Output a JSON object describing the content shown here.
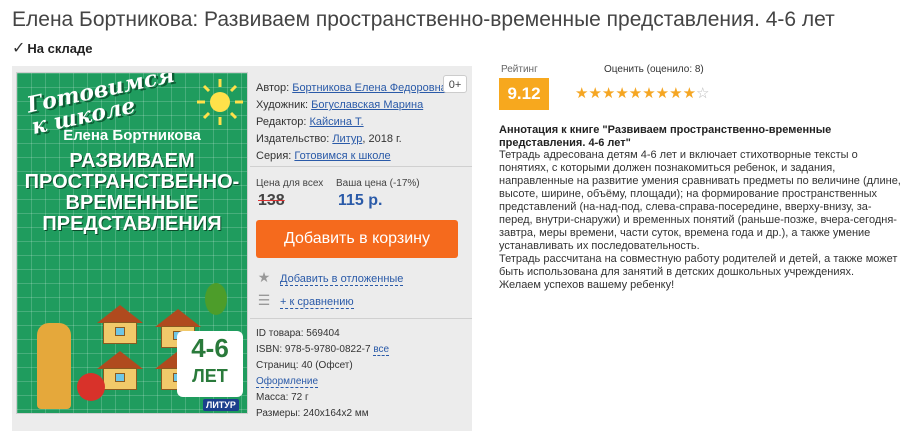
{
  "product": {
    "title": "Елена Бортникова: Развиваем пространственно-временные представления. 4-6 лет",
    "stock": "На складе"
  },
  "cover": {
    "series": "Готовимся к школе",
    "author": "Елена Бортникова",
    "title": "РАЗВИВАЕМ ПРОСТРАНСТВЕННО-ВРЕМЕННЫЕ ПРЕДСТАВЛЕНИЯ",
    "age_num": "4-6",
    "age_unit": "ЛЕТ",
    "publisher": "ЛИТУР"
  },
  "details": {
    "author_label": "Автор:",
    "author": "Бортникова Елена Федоровна",
    "artist_label": "Художник:",
    "artist": "Богуславская Марина",
    "editor_label": "Редактор:",
    "editor": "Кайсина Т.",
    "publisher_label": "Издательство:",
    "publisher": "Литур",
    "year": ", 2018 г.",
    "series_label": "Серия:",
    "series": "Готовимся к школе",
    "badge": "0+"
  },
  "prices": {
    "all_label": "Цена для всех",
    "old": "138",
    "your_label": "Ваша цена (-17%)",
    "new": "115 р."
  },
  "actions": {
    "cart": "Добавить в корзину",
    "wishlist": "Добавить в отложенные",
    "compare": "+ к сравнению"
  },
  "meta": {
    "id_label": "ID товара:",
    "id": "569404",
    "isbn_label": "ISBN:",
    "isbn": "978-5-9780-0822-7",
    "isbn_all": "все",
    "pages_label": "Страниц:",
    "pages": "40 (Офсет)",
    "design": "Оформление",
    "weight_label": "Масса:",
    "weight": "72 г",
    "size_label": "Размеры:",
    "size": "240x164x2 мм"
  },
  "rating": {
    "label": "Рейтинг",
    "value": "9.12",
    "rate_label": "Оценить (оценило: 8)",
    "stars_filled": "★★★★★★★★★",
    "stars_empty": "☆"
  },
  "annotation": {
    "title": "Аннотация к книге \"Развиваем пространственно-временные представления. 4-6 лет\"",
    "p1": "Тетрадь адресована детям 4-6 лет и включает стихотворные тексты о понятиях, с которыми должен познакомиться ребенок, и задания, направленные на развитие умения сравнивать предметы по величине (длине, высоте, ширине, объёму, площади); на формирование пространственных представлений (на-над-под, слева-справа-посередине, вверху-внизу, за-перед, внутри-снаружи) и временных понятий (раньше-позже, вчера-сегодня-завтра, меры времени, части суток, времена года и др.), а также умение устанавливать их последовательность.",
    "p2": "Тетрадь рассчитана на совместную работу родителей и детей, а также может быть использована для занятий в детских дошкольных учреждениях.",
    "p3": "Желаем успехов вашему ребенку!"
  }
}
